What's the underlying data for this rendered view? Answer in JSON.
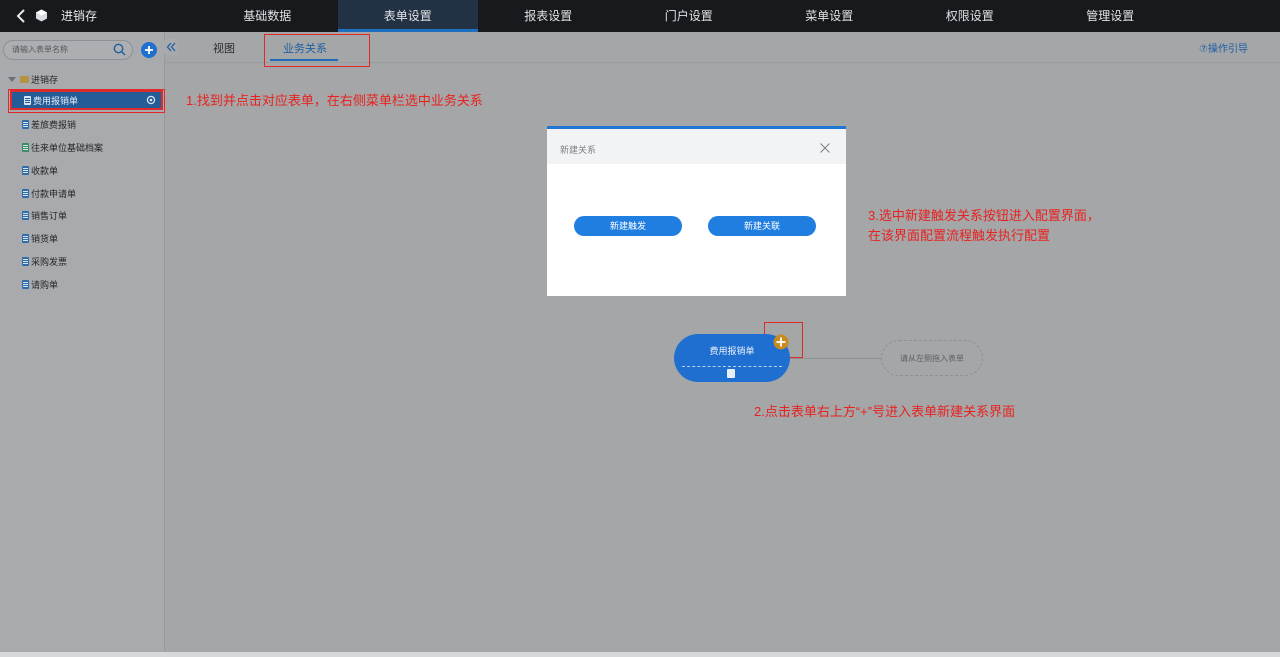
{
  "topbar": {
    "app_title": "进销存",
    "nav": [
      "基础数据",
      "表单设置",
      "报表设置",
      "门户设置",
      "菜单设置",
      "权限设置",
      "管理设置"
    ],
    "active_nav": "表单设置"
  },
  "sidebar": {
    "search_placeholder": "请输入表单名称",
    "root": "进销存",
    "items": [
      {
        "label": "费用报销单",
        "selected": true
      },
      {
        "label": "差旅费报销"
      },
      {
        "label": "往来单位基础档案"
      },
      {
        "label": "收款单"
      },
      {
        "label": "付款申请单"
      },
      {
        "label": "销售订单"
      },
      {
        "label": "销货单"
      },
      {
        "label": "采购发票"
      },
      {
        "label": "请购单"
      }
    ]
  },
  "tabs": {
    "view": "视图",
    "business": "业务关系",
    "active": "业务关系",
    "help": "⑦操作引导"
  },
  "annotations": {
    "step1": "1.找到并点击对应表单，在右侧菜单栏选中业务关系",
    "step2": "2.点击表单右上方“+”号进入表单新建关系界面",
    "step3_line1": "3.选中新建触发关系按钮进入配置界面，",
    "step3_line2": "在该界面配置流程触发执行配置"
  },
  "dialog": {
    "title": "新建关系",
    "btn_trigger": "新建触发",
    "btn_link": "新建关联"
  },
  "flow": {
    "node_label": "费用报销单",
    "drop_label": "请从左侧拖入表单"
  },
  "colors": {
    "accent": "#1f7ee0",
    "annotation_red": "#e8221f",
    "topbar": "#17191d"
  }
}
